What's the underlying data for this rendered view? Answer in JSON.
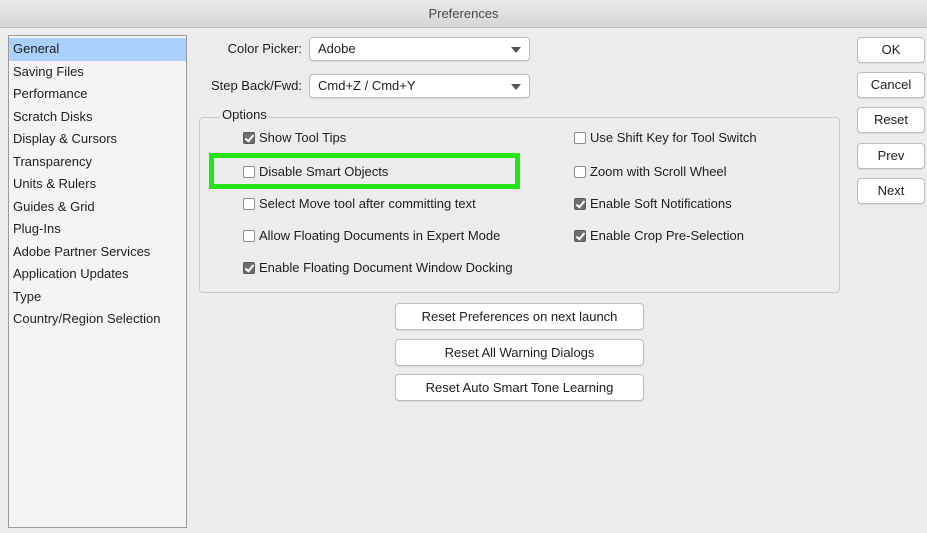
{
  "window": {
    "title": "Preferences"
  },
  "sidebar": {
    "items": [
      {
        "label": "General",
        "selected": true
      },
      {
        "label": "Saving Files"
      },
      {
        "label": "Performance"
      },
      {
        "label": "Scratch Disks"
      },
      {
        "label": "Display & Cursors"
      },
      {
        "label": "Transparency"
      },
      {
        "label": "Units & Rulers"
      },
      {
        "label": "Guides & Grid"
      },
      {
        "label": "Plug-Ins"
      },
      {
        "label": "Adobe Partner Services"
      },
      {
        "label": "Application Updates"
      },
      {
        "label": "Type"
      },
      {
        "label": "Country/Region Selection"
      }
    ]
  },
  "fields": {
    "color_picker": {
      "label": "Color Picker:",
      "value": "Adobe"
    },
    "step_back": {
      "label": "Step Back/Fwd:",
      "value": "Cmd+Z / Cmd+Y"
    }
  },
  "options": {
    "legend": "Options",
    "checkboxes": [
      {
        "label": "Show Tool Tips",
        "checked": true
      },
      {
        "label": "Disable Smart Objects",
        "checked": false
      },
      {
        "label": "Select Move tool after committing text",
        "checked": false
      },
      {
        "label": "Allow Floating Documents in Expert Mode",
        "checked": false
      },
      {
        "label": "Enable Floating Document Window Docking",
        "checked": true
      },
      {
        "label": "Use Shift Key for Tool Switch",
        "checked": false
      },
      {
        "label": "Zoom with Scroll Wheel",
        "checked": false
      },
      {
        "label": "Enable Soft Notifications",
        "checked": true
      },
      {
        "label": "Enable Crop Pre-Selection",
        "checked": true
      }
    ]
  },
  "reset_buttons": {
    "preferences": "Reset Preferences on next launch",
    "warnings": "Reset All Warning Dialogs",
    "smart_tone": "Reset Auto Smart Tone Learning"
  },
  "dialog_buttons": {
    "ok": "OK",
    "cancel": "Cancel",
    "reset": "Reset",
    "prev": "Prev",
    "next": "Next"
  },
  "colors": {
    "selection": "#a9d1fb",
    "highlight_box": "#25e517"
  }
}
